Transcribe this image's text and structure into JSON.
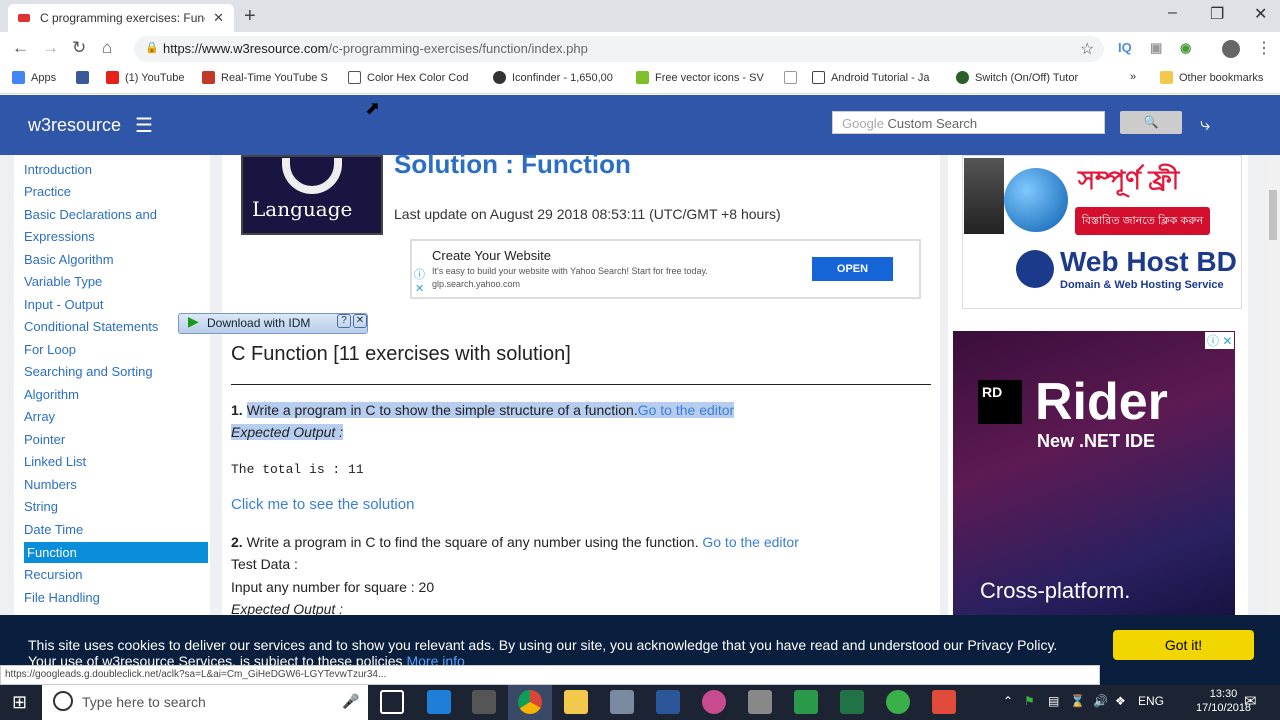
{
  "browser": {
    "tab_title": "C programming exercises: Functi",
    "url_host": "https://www.w3resource.com",
    "url_path": "/c-programming-exercises/function/index.php",
    "new_tab": "+",
    "close": "✕"
  },
  "bookmarks": [
    {
      "label": "Apps",
      "color": "#4285f4"
    },
    {
      "label": "",
      "color": "#3b5998"
    },
    {
      "label": "(1) YouTube",
      "color": "#e62117"
    },
    {
      "label": "Real-Time YouTube S",
      "color": "#c0392b"
    },
    {
      "label": "Color Hex Color Cod",
      "color": "#555555"
    },
    {
      "label": "Iconfinder - 1,650,00",
      "color": "#333333"
    },
    {
      "label": "Free vector icons - SV",
      "color": "#7fbf2a"
    },
    {
      "label": "",
      "color": "#999999"
    },
    {
      "label": "Android Tutorial - Ja",
      "color": "#444444"
    },
    {
      "label": "Switch (On/Off) Tutor",
      "color": "#2a5f2a"
    },
    {
      "label": "Other bookmarks",
      "color": "#f2c94c"
    }
  ],
  "site": {
    "logo": "w3resource",
    "search_placeholder": "Google Custom Search",
    "search_brand": "Google"
  },
  "sidebar": {
    "items": [
      "Introduction",
      "Practice",
      "Basic Declarations and",
      "Expressions",
      "Basic Algorithm",
      "Variable Type",
      "Input - Output",
      "Conditional Statements",
      "For Loop",
      "Searching and Sorting",
      "Algorithm",
      "Array",
      "Pointer",
      "Linked List",
      "Numbers",
      "String",
      "Date Time",
      "Function",
      "Recursion",
      "File Handling"
    ],
    "active": "Function"
  },
  "main": {
    "logo_text": "Language",
    "heading": "Solution : Function",
    "last_update": "Last update on August 29 2018 08:53:11 (UTC/GMT +8 hours)",
    "section_title": "C Function [11 exercises with solution]",
    "ex1_num": "1.",
    "ex1_text": "Write a program in C to show the simple structure of a function.",
    "ex1_link": "Go to the editor",
    "expected_output": "Expected Output :",
    "ex1_output": "The total is :  11",
    "solution_link": "Click me to see the solution",
    "ex2_num": "2.",
    "ex2_text": "Write a program in C to find the square of any number using the function.",
    "ex2_link": "Go to the editor",
    "test_data": "Test Data :",
    "ex2_input": "Input any number for square : 20"
  },
  "ads": {
    "ad1_title": "Create Your Website",
    "ad1_desc": "It's easy to build your website with Yahoo Search! Start for free today.",
    "ad1_url": "glp.search.yahoo.com",
    "ad1_button": "OPEN",
    "ad2_bengali": "সম্পূর্ণ ফ্রী",
    "ad2_button": "বিস্তারিত জানতে ক্লিক করুন",
    "ad2_brand": "Web Host BD",
    "ad2_tagline": "Domain & Web Hosting Service",
    "ad3_rd": "RD",
    "ad3_title": "Rider",
    "ad3_sub": "New .NET IDE",
    "ad3_cross": "Cross-platform."
  },
  "idm": {
    "label": "Download with IDM"
  },
  "cookie": {
    "text": "This site uses cookies to deliver our services and to show you relevant ads. By using our site, you acknowledge that you have read and understood our Privacy Policy.",
    "text2": "Your use of w3resource Services, is subject to these policies",
    "more": "More info",
    "button": "Got it!"
  },
  "status_url": "https://googleads.g.doubleclick.net/aclk?sa=L&ai=Cm_GiHeDGW6-LGYTevwTzur34...",
  "taskbar": {
    "search_placeholder": "Type here to search",
    "lang": "ENG",
    "time": "13:30",
    "date": "17/10/2018"
  }
}
